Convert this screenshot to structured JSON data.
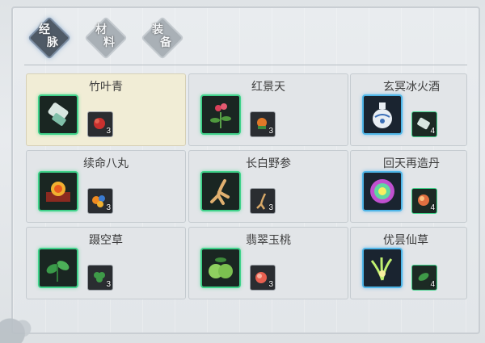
{
  "tabs": [
    {
      "line1": "经",
      "line2": "脉",
      "active": true
    },
    {
      "line1": "材",
      "line2": "料",
      "active": false
    },
    {
      "line1": "装",
      "line2": "备",
      "active": false
    }
  ],
  "items": [
    {
      "name": "竹叶青",
      "count": "3",
      "selected": true,
      "icon": "scroll-icon",
      "rarity": "green",
      "mat": "red-herb-icon"
    },
    {
      "name": "红景天",
      "count": "3",
      "selected": false,
      "icon": "red-flower-herb-icon",
      "rarity": "green",
      "mat": "orange-herb-icon"
    },
    {
      "name": "玄冥冰火酒",
      "count": "4",
      "selected": false,
      "icon": "porcelain-vase-icon",
      "rarity": "blue",
      "mat": "scroll-icon"
    },
    {
      "name": "续命八丸",
      "count": "3",
      "selected": false,
      "icon": "pill-box-icon",
      "rarity": "green",
      "mat": "pills-icon"
    },
    {
      "name": "长白野参",
      "count": "3",
      "selected": false,
      "icon": "ginseng-root-icon",
      "rarity": "green",
      "mat": "root-icon"
    },
    {
      "name": "回天再造丹",
      "count": "4",
      "selected": false,
      "icon": "glowing-pill-icon",
      "rarity": "blue",
      "mat": "orb-icon"
    },
    {
      "name": "蹑空草",
      "count": "3",
      "selected": false,
      "icon": "green-leaf-herb-icon",
      "rarity": "green",
      "mat": "clover-icon"
    },
    {
      "name": "翡翠玉桃",
      "count": "3",
      "selected": false,
      "icon": "jade-peach-icon",
      "rarity": "green",
      "mat": "peach-icon"
    },
    {
      "name": "优昙仙草",
      "count": "4",
      "selected": false,
      "icon": "glowing-grass-icon",
      "rarity": "blue",
      "mat": "leaf-icon"
    }
  ]
}
